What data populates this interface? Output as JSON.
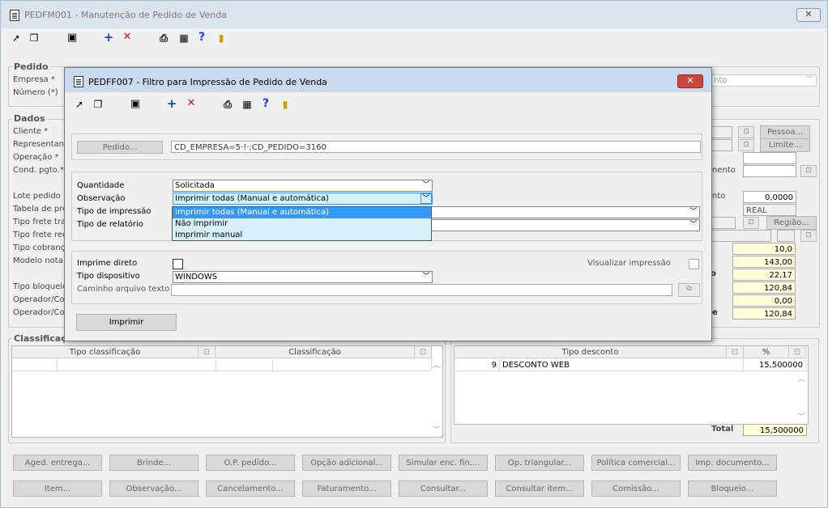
{
  "main_window": {
    "title": "PEDFM001 - Manutenção de Pedido de Venda",
    "close_label": "✕",
    "pedido_section": {
      "legend": "Pedido",
      "empresa_label": "Empresa *",
      "numero_label": "Número (*)",
      "right_combo_value": "nto"
    },
    "dados_section": {
      "legend": "Dados",
      "labels": [
        "Cliente *",
        "Representan",
        "Operação *",
        "Cond. pgto.*/",
        "Lote pedido",
        "Tabela de pre",
        "Tipo frete tra",
        "Tipo frete rec",
        "Tipo cobranç",
        "Modelo nota",
        "Tipo bloqueio",
        "Operador/Co",
        "Operador/Co"
      ],
      "pessoa_button": "Pessoa...",
      "limite_button": "Limite...",
      "regiao_button": "Região...",
      "right_labels": [
        "nento",
        "nto",
        "o",
        "e"
      ],
      "values": {
        "lote_pedido_right": "0,0000",
        "tabela_right": "REAL",
        "v1": "10,0",
        "v2": "143,00",
        "v3": "22,17",
        "v4": "120,84",
        "v5": "0,00",
        "v6": "120,84"
      }
    },
    "classificacao": {
      "legend": "Classificação",
      "columns": [
        "Tipo classificação",
        "Classificação"
      ]
    },
    "desconto": {
      "columns": [
        "Tipo desconto",
        "%"
      ],
      "rows": [
        {
          "code": "9",
          "desc": "DESCONTO WEB",
          "pct": "15,500000"
        }
      ],
      "total_label": "Total",
      "total_value": "15,500000"
    },
    "bottom_buttons_row1": [
      "Aged. entrega...",
      "Brinde...",
      "O.P. pedido...",
      "Opção adicional...",
      "Simular enc. fin....",
      "Op. triangular...",
      "Política comercial...",
      "Imp. documento..."
    ],
    "bottom_buttons_row2": [
      "Item...",
      "Observação...",
      "Cancelamento...",
      "Faturamento...",
      "Consultar...",
      "Consultar item...",
      "Comissão...",
      "Bloqueio..."
    ]
  },
  "dialog": {
    "title": "PEDFF007 - Filtro para Impressão de Pedido de Venda",
    "close_label": "✕",
    "pedido_button": "Pedido...",
    "pedido_value": "CD_EMPRESA=5·!·;CD_PEDIDO=3160",
    "quantidade_label": "Quantidade",
    "quantidade_value": "Solicitada",
    "observacao_label": "Observação",
    "observacao_value": "Imprimir todas (Manual e automática)",
    "tipo_impressao_label": "Tipo de impressão",
    "tipo_relatorio_label": "Tipo de relatório",
    "observacao_options": [
      "Imprimir todas (Manual e automática)",
      "Não imprimir",
      "Imprimir manual"
    ],
    "imprime_direto_label": "Imprime direto",
    "visualizar_label": "Visualizar impressão",
    "tipo_dispositivo_label": "Tipo dispositivo",
    "tipo_dispositivo_value": "WINDOWS",
    "caminho_label": "Caminho arquivo texto",
    "caminho_value": "",
    "imprimir_button": "Imprimir"
  },
  "toolbar_icons": [
    "select-icon",
    "copy-icon",
    "save-icon",
    "add-icon",
    "delete-icon",
    "print-icon",
    "calendar-icon",
    "help-icon",
    "exit-icon"
  ],
  "colors": {
    "accent_blue": "#1a3fd8",
    "delete_red": "#d01010",
    "selection": "#3399ff",
    "field_yellow": "#fffed9",
    "dropdown_bg": "#d4f0f8"
  }
}
